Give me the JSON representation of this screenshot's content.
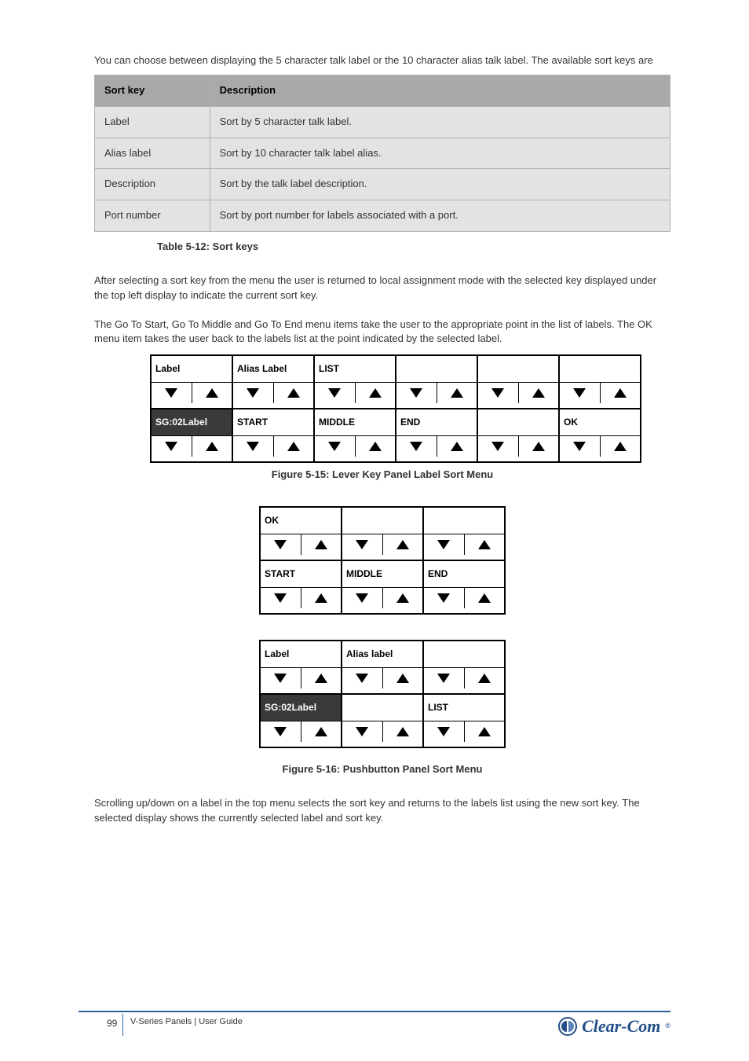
{
  "intro_paragraph": "You can choose between displaying the 5 character talk label or the 10 character alias talk label. The available sort keys are",
  "table": {
    "headers": [
      "Sort key",
      "Description"
    ],
    "rows": [
      [
        "Label",
        "Sort by 5 character talk label."
      ],
      [
        "Alias label",
        "Sort by 10 character talk label alias."
      ],
      [
        "Description",
        "Sort by the talk label description."
      ],
      [
        "Port number",
        "Sort by port number for labels associated with a port."
      ]
    ]
  },
  "table_caption": "Table 5-12: Sort keys",
  "after_table_p1": "After selecting a sort key from the menu the user is returned to local assignment mode with the selected key displayed under the top left display to indicate the current sort key.",
  "after_table_p2": "The Go To Start, Go To Middle and Go To End menu items take the user to the appropriate point in the list of labels. The OK menu item takes the user back to the labels list at the point indicated by the selected label.",
  "figure1": {
    "row1": [
      "Label",
      "Alias Label",
      "LIST",
      "",
      "",
      ""
    ],
    "row1_selected": [
      false,
      false,
      false,
      false,
      false,
      false
    ],
    "row2": [
      "SG:02Label",
      "START",
      "MIDDLE",
      "END",
      "",
      "OK"
    ],
    "row2_selected": [
      true,
      false,
      false,
      false,
      false,
      false
    ],
    "caption": "Figure 5-15: Lever Key Panel Label Sort Menu"
  },
  "figure2": {
    "group_top": {
      "row1": [
        "OK",
        "",
        ""
      ],
      "row2": [
        "START",
        "MIDDLE",
        "END"
      ]
    },
    "group_bottom": {
      "row1": [
        "Label",
        "Alias label",
        ""
      ],
      "row2": [
        "SG:02Label",
        "",
        "LIST"
      ],
      "row2_selected": [
        true,
        false,
        false
      ]
    },
    "caption": "Figure 5-16: Pushbutton Panel Sort Menu"
  },
  "after_fig_p": "Scrolling up/down on a label in the top menu selects the sort key and returns to the labels list using the new sort key. The selected display shows the currently selected label and sort key.",
  "footer": {
    "page": "99",
    "line1": "V-Series Panels | User Guide",
    "logo_text": "Clear-Com"
  }
}
